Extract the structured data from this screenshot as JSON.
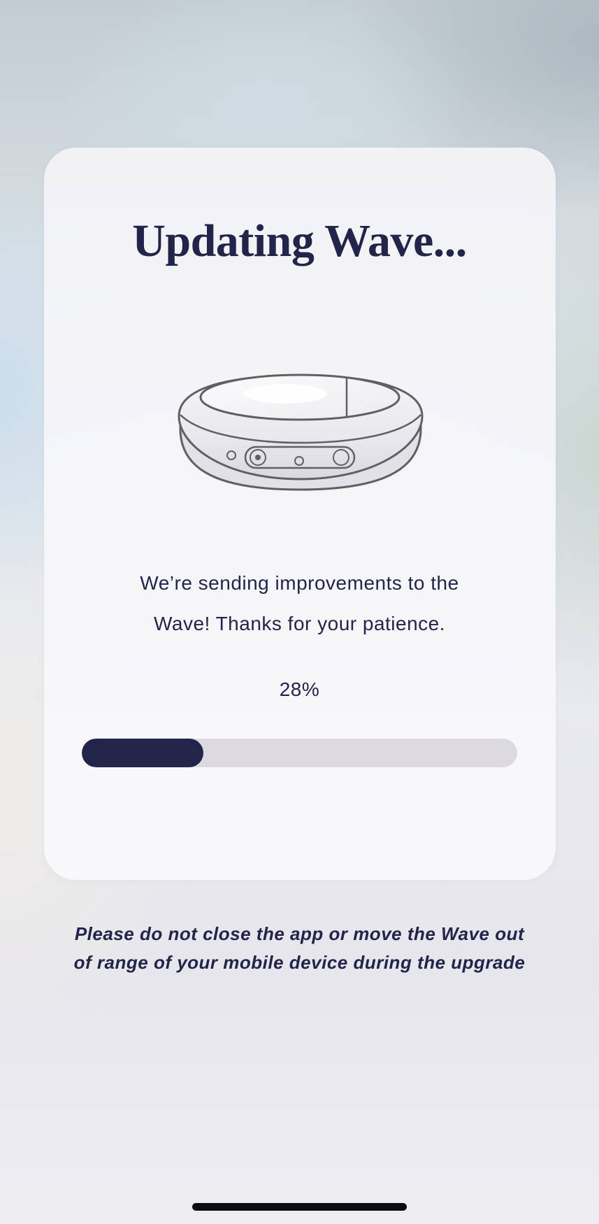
{
  "screen": {
    "title": "Updating Wave...",
    "message_lines": [
      "We’re sending improvements to the",
      "Wave! Thanks for your patience."
    ],
    "progress": {
      "label": "28%",
      "value_percent": 28
    },
    "warning_lines": [
      "Please do not close the app or move the Wave out",
      "of range of your mobile device during the upgrade"
    ]
  },
  "icons": {
    "device": "wave-device-illustration"
  },
  "colors": {
    "primary": "#22244a",
    "progress_track": "#dcdadf",
    "card_background": "#f5f5f8"
  }
}
